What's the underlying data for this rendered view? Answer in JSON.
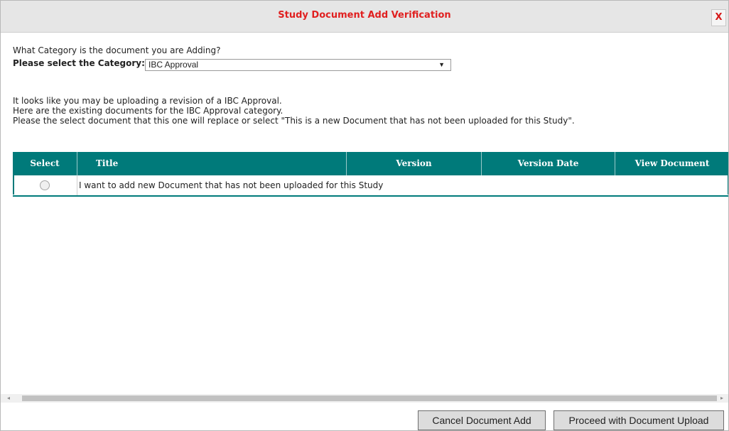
{
  "dialog": {
    "title": "Study Document Add Verification",
    "close_label": "X"
  },
  "form": {
    "question": "What Category is the document you are Adding?",
    "category_label": "Please select the Category:",
    "category_value": "IBC Approval",
    "arrow": "▼"
  },
  "info": {
    "line1": "It looks like you may be uploading a revision of a IBC Approval.",
    "line2": "Here are the existing documents for the IBC Approval category.",
    "line3": "Please the select document that this one will replace or select \"This is a new Document that has not been uploaded for this Study\"."
  },
  "table": {
    "columns": [
      "Select",
      "Title",
      "Version",
      "Version Date",
      "View Document"
    ],
    "rows": [
      {
        "title": "I want to add new Document that has not been uploaded for this Study",
        "version": "",
        "version_date": "",
        "view": ""
      }
    ]
  },
  "scrollbar": {
    "left_arrow": "◂",
    "right_arrow": "▸"
  },
  "buttons": {
    "cancel": "Cancel Document Add",
    "proceed": "Proceed with Document Upload"
  },
  "colors": {
    "title_red": "#e01f1f",
    "header_teal": "#007a7a",
    "button_gray": "#dcdcdc"
  }
}
